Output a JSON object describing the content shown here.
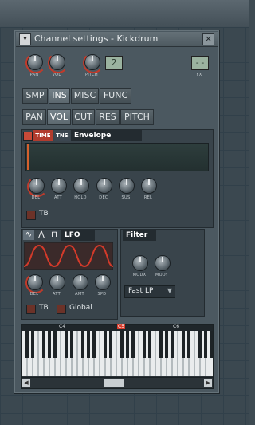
{
  "window": {
    "title": "Channel settings - Kickdrum",
    "menu_glyph": "▾",
    "close_glyph": "×"
  },
  "top": {
    "knobs": [
      {
        "label": "PAN"
      },
      {
        "label": "VOL"
      },
      {
        "label": "PITCH"
      }
    ],
    "pitch_lcd": "2",
    "fx_label": "FX",
    "fx_lcd": "--"
  },
  "tabs_row1": [
    "SMP",
    "INS",
    "MISC",
    "FUNC"
  ],
  "tabs_row2": [
    "PAN",
    "VOL",
    "CUT",
    "RES",
    "PITCH"
  ],
  "envelope": {
    "time_label": "TIME",
    "tns_label": "TNS",
    "title": "Envelope",
    "knobs": [
      "DEL",
      "ATT",
      "HOLD",
      "DEC",
      "SUS",
      "REL"
    ],
    "tb_label": "TB"
  },
  "lfo": {
    "title": "LFO",
    "knobs": [
      "DEL",
      "ATT",
      "AMT",
      "SPD"
    ],
    "tb_label": "TB",
    "global_label": "Global"
  },
  "filter": {
    "title": "Filter",
    "knobs": [
      "MODX",
      "MODY"
    ],
    "type": "Fast LP"
  },
  "keyboard": {
    "labels": [
      "C4",
      "C5",
      "C6"
    ],
    "active_label": "C5",
    "accent": "#d83a2a"
  }
}
